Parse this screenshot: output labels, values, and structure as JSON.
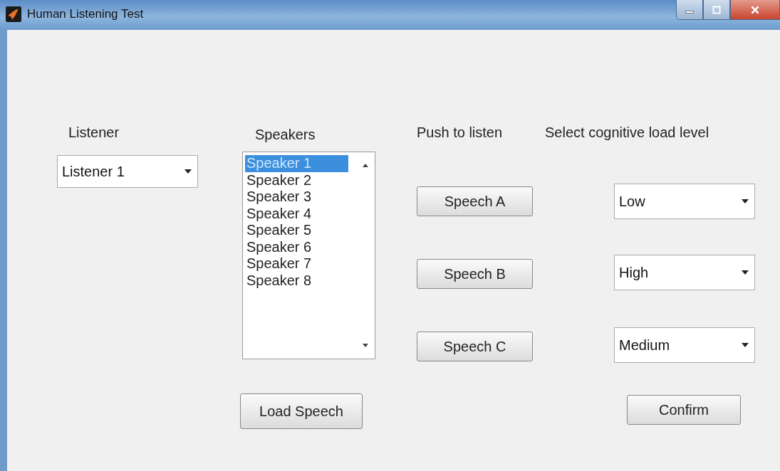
{
  "window": {
    "title": "Human Listening Test"
  },
  "listener": {
    "label": "Listener",
    "value": "Listener 1"
  },
  "speakers": {
    "label": "Speakers",
    "items": [
      {
        "label": "Speaker 1",
        "selected": true
      },
      {
        "label": "Speaker 2",
        "selected": false
      },
      {
        "label": "Speaker 3",
        "selected": false
      },
      {
        "label": "Speaker 4",
        "selected": false
      },
      {
        "label": "Speaker 5",
        "selected": false
      },
      {
        "label": "Speaker 6",
        "selected": false
      },
      {
        "label": "Speaker 7",
        "selected": false
      },
      {
        "label": "Speaker 8",
        "selected": false
      }
    ],
    "button": "Load Speech"
  },
  "playback": {
    "label": "Push to listen",
    "buttons": [
      "Speech A",
      "Speech B",
      "Speech C"
    ]
  },
  "cognitive_load": {
    "label": "Select cognitive load level",
    "selects": [
      {
        "value": "Low"
      },
      {
        "value": "High"
      },
      {
        "value": "Medium"
      }
    ],
    "button": "Confirm"
  }
}
